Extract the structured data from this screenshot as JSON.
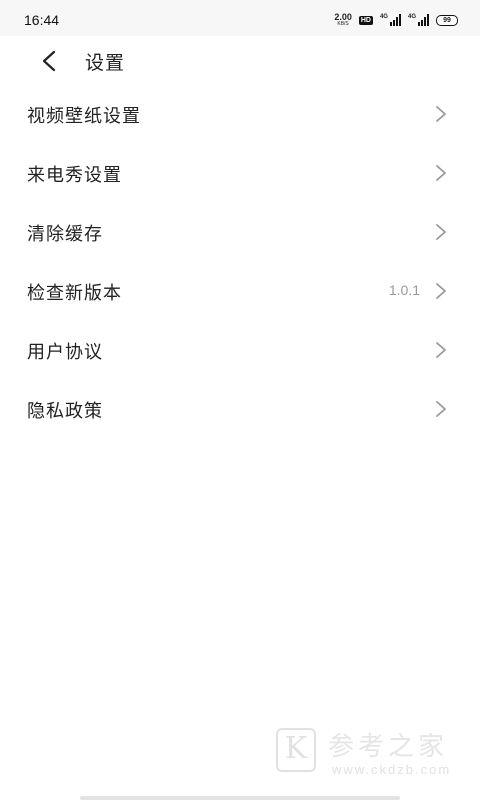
{
  "status_bar": {
    "time": "16:44",
    "net_speed_value": "2.00",
    "net_speed_unit": "KB/S",
    "hd_badge": "HD",
    "signal1_label": "4G",
    "signal2_label": "4G",
    "battery": "99"
  },
  "header": {
    "title": "设置",
    "back_icon": "chevron-left-icon"
  },
  "settings": {
    "items": [
      {
        "label": "视频壁纸设置",
        "value": ""
      },
      {
        "label": "来电秀设置",
        "value": ""
      },
      {
        "label": "清除缓存",
        "value": ""
      },
      {
        "label": "检查新版本",
        "value": "1.0.1"
      },
      {
        "label": "用户协议",
        "value": ""
      },
      {
        "label": "隐私政策",
        "value": ""
      }
    ],
    "chevron_icon": "chevron-right-icon"
  },
  "watermark": {
    "logo_letter": "K",
    "title": "参考之家",
    "url": "www.ckdzb.com"
  },
  "colors": {
    "text": "#222222",
    "secondary_text": "#999999",
    "chevron": "#9a9a9a",
    "status_bar_bg": "#f7f7f7"
  }
}
